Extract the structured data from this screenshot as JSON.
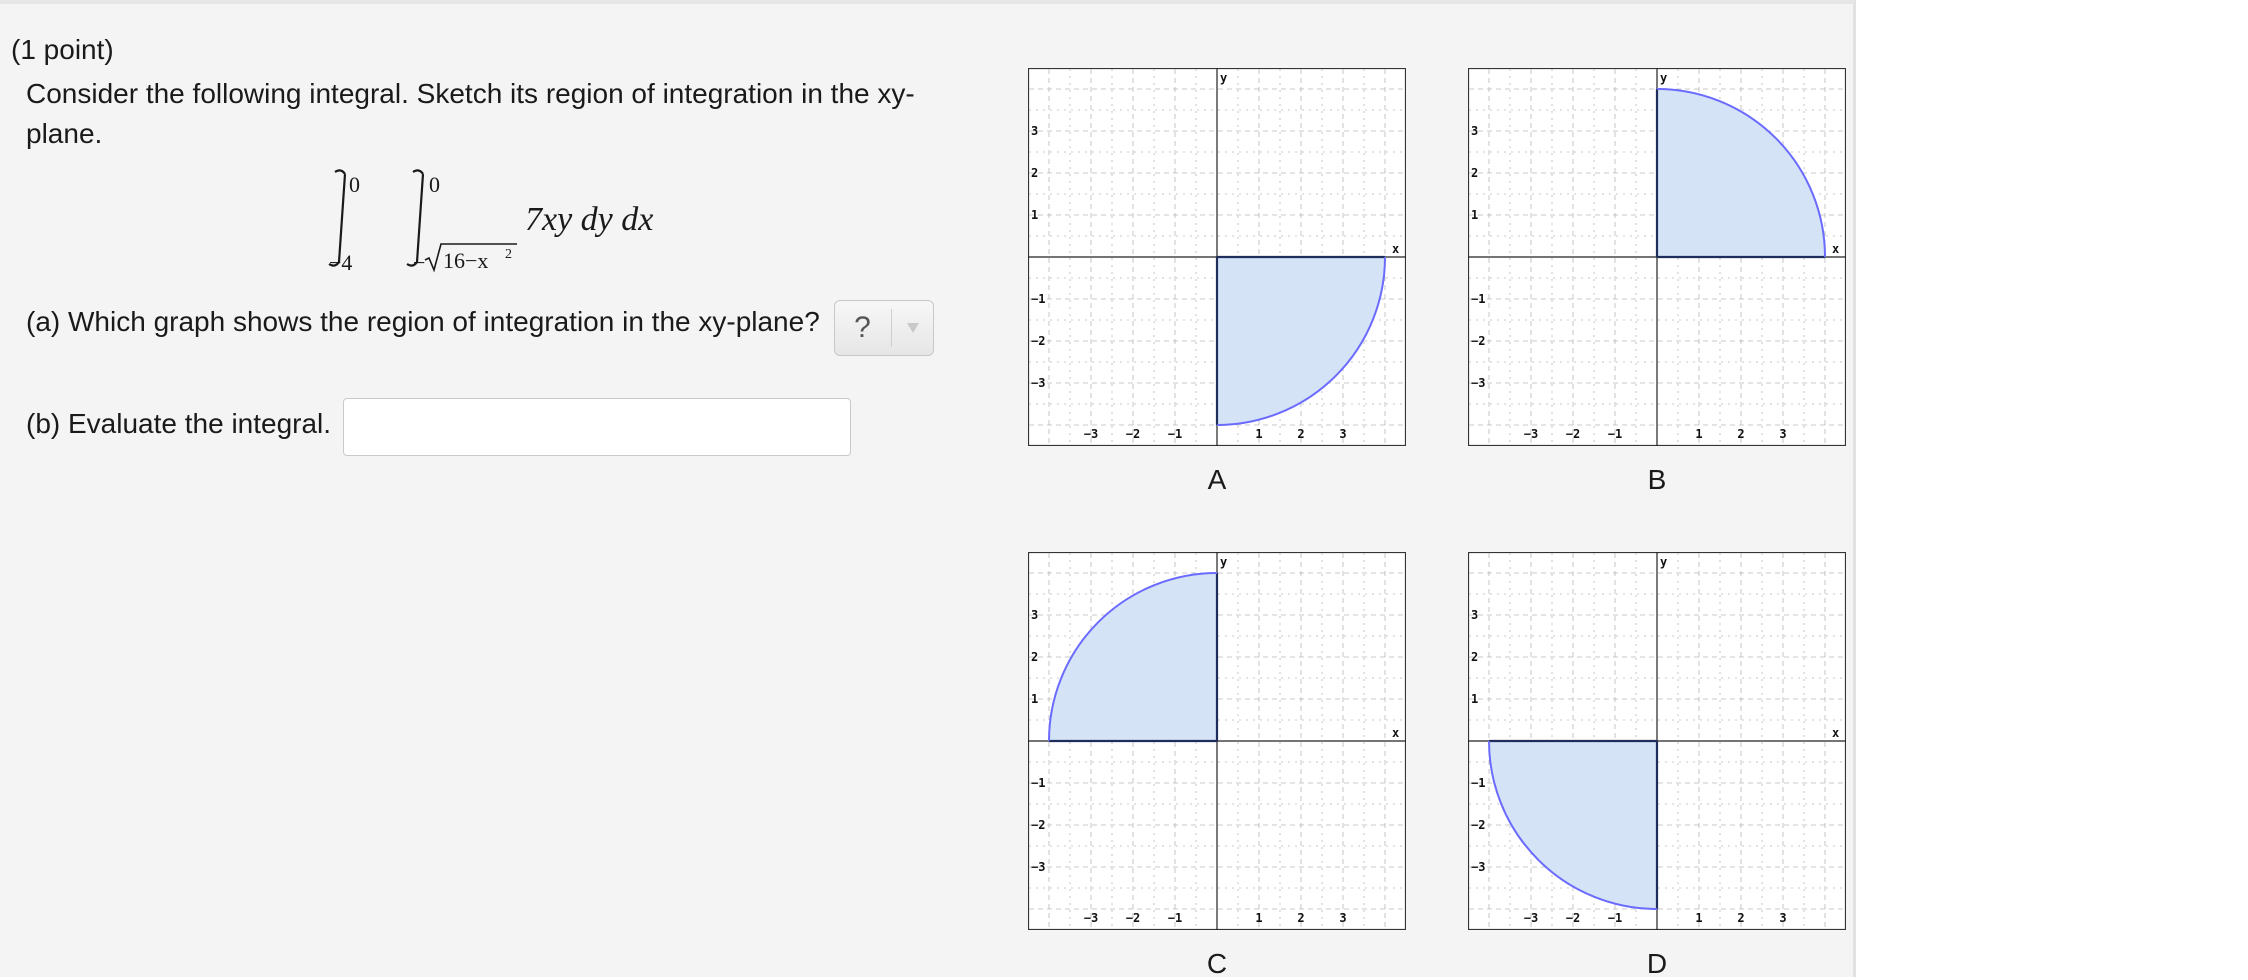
{
  "problem": {
    "points": "(1 point)",
    "question": "Consider the following integral. Sketch its region of integration in the xy-plane.",
    "math": {
      "outer_upper": "0",
      "outer_lower": "−4",
      "inner_upper": "0",
      "inner_lower_minus": "−",
      "inner_lower_radicand": "16−x",
      "inner_lower_exp": "2",
      "integrand": "7xy dy dx"
    },
    "part_a": {
      "text": "(a) Which graph shows the region of integration in the xy-plane?",
      "dropdown_value": "?"
    },
    "part_b": {
      "text": "(b) Evaluate the integral.",
      "answer_value": ""
    }
  },
  "graphs": [
    {
      "label": "A",
      "quadrant": 4
    },
    {
      "label": "B",
      "quadrant": 1
    },
    {
      "label": "C",
      "quadrant": 2
    },
    {
      "label": "D",
      "quadrant": 3
    }
  ],
  "axis": {
    "x_label": "x",
    "y_label": "y",
    "x_ticks": [
      "−3",
      "−2",
      "−1",
      "1",
      "2",
      "3"
    ],
    "y_ticks": [
      "3",
      "2",
      "1",
      "−1",
      "−2",
      "−3"
    ],
    "radius": 4
  },
  "colors": {
    "region_fill": "#d4e3f5",
    "arc_stroke": "#6b6bff",
    "edge_stroke": "#1f2d5c",
    "grid": "#b8b8b8"
  }
}
